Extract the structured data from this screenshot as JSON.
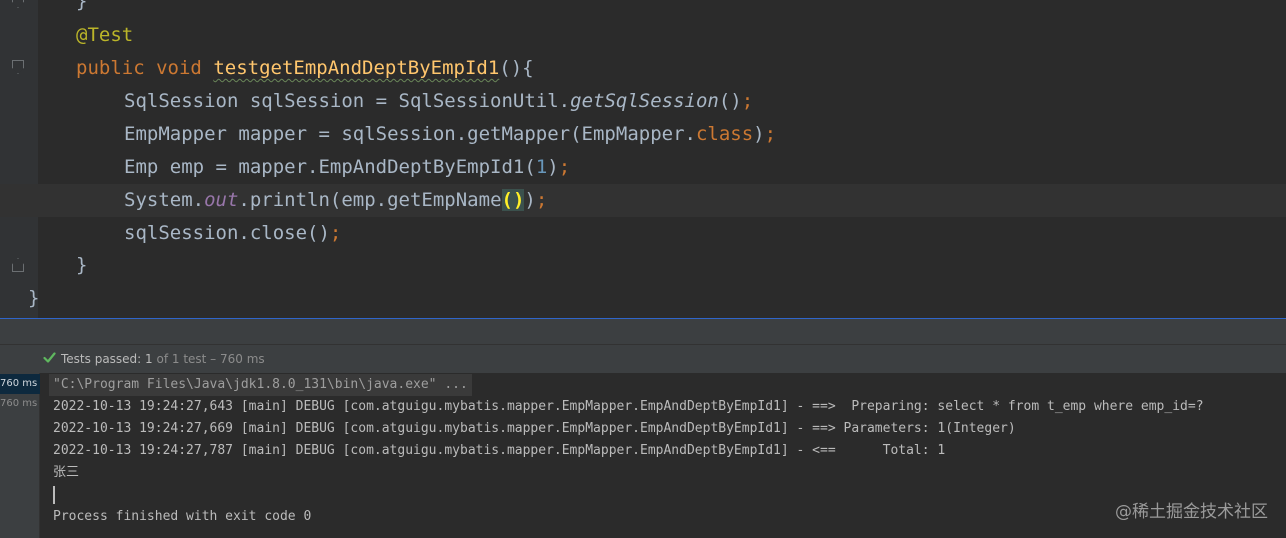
{
  "editor": {
    "lines": [
      {
        "id": "l0",
        "text": "}"
      },
      {
        "id": "l1",
        "annotation": "@Test"
      },
      {
        "id": "l2",
        "kw1": "public",
        "kw2": "void",
        "method": "testgetEmpAndDeptByEmpId1",
        "rest": "(){"
      },
      {
        "id": "l3",
        "a": "SqlSession sqlSession = SqlSessionUtil.",
        "b": "getSqlSession",
        "c": "()",
        "semi": ";"
      },
      {
        "id": "l4",
        "a": "EmpMapper mapper = sqlSession.getMapper(EmpMapper.",
        "kw": "class",
        "c": ")",
        "semi": ";"
      },
      {
        "id": "l5",
        "a": "Emp emp = mapper.EmpAndDeptByEmpId1(",
        "num": "1",
        "c": ")",
        "semi": ";"
      },
      {
        "id": "l6",
        "a": "System.",
        "field": "out",
        "b": ".println(emp.getEmpName",
        "paren": "()",
        "c": ")",
        "semi": ";"
      },
      {
        "id": "l7",
        "a": "sqlSession.close()",
        "semi": ";"
      },
      {
        "id": "l8",
        "text": "}"
      },
      {
        "id": "l9",
        "text": "}"
      }
    ]
  },
  "run_panel": {
    "status_label": "Tests passed: ",
    "status_count": "1",
    "status_suffix": " of 1 test – 760 ms",
    "tree": [
      {
        "label": "760 ms",
        "selected": true
      },
      {
        "label": "760 ms",
        "selected": false
      }
    ],
    "console": {
      "command": "\"C:\\Program Files\\Java\\jdk1.8.0_131\\bin\\java.exe\" ...",
      "logs": [
        "2022-10-13 19:24:27,643 [main] DEBUG [com.atguigu.mybatis.mapper.EmpMapper.EmpAndDeptByEmpId1] - ==>  Preparing: select * from t_emp where emp_id=?",
        "2022-10-13 19:24:27,669 [main] DEBUG [com.atguigu.mybatis.mapper.EmpMapper.EmpAndDeptByEmpId1] - ==> Parameters: 1(Integer)",
        "2022-10-13 19:24:27,787 [main] DEBUG [com.atguigu.mybatis.mapper.EmpMapper.EmpAndDeptByEmpId1] - <==      Total: 1"
      ],
      "output": "张三",
      "exit": "Process finished with exit code 0"
    }
  },
  "watermark": "@稀土掘金技术社区",
  "colors": {
    "editor_bg": "#2b2b2b",
    "keyword": "#cc7832",
    "annotation": "#bbb529",
    "method_decl": "#ffc66d",
    "number": "#6897bb",
    "field": "#9876aa",
    "passed_green": "#5fb85f"
  },
  "icons": [
    "checkmark-icon",
    "fold-marker-icon"
  ]
}
